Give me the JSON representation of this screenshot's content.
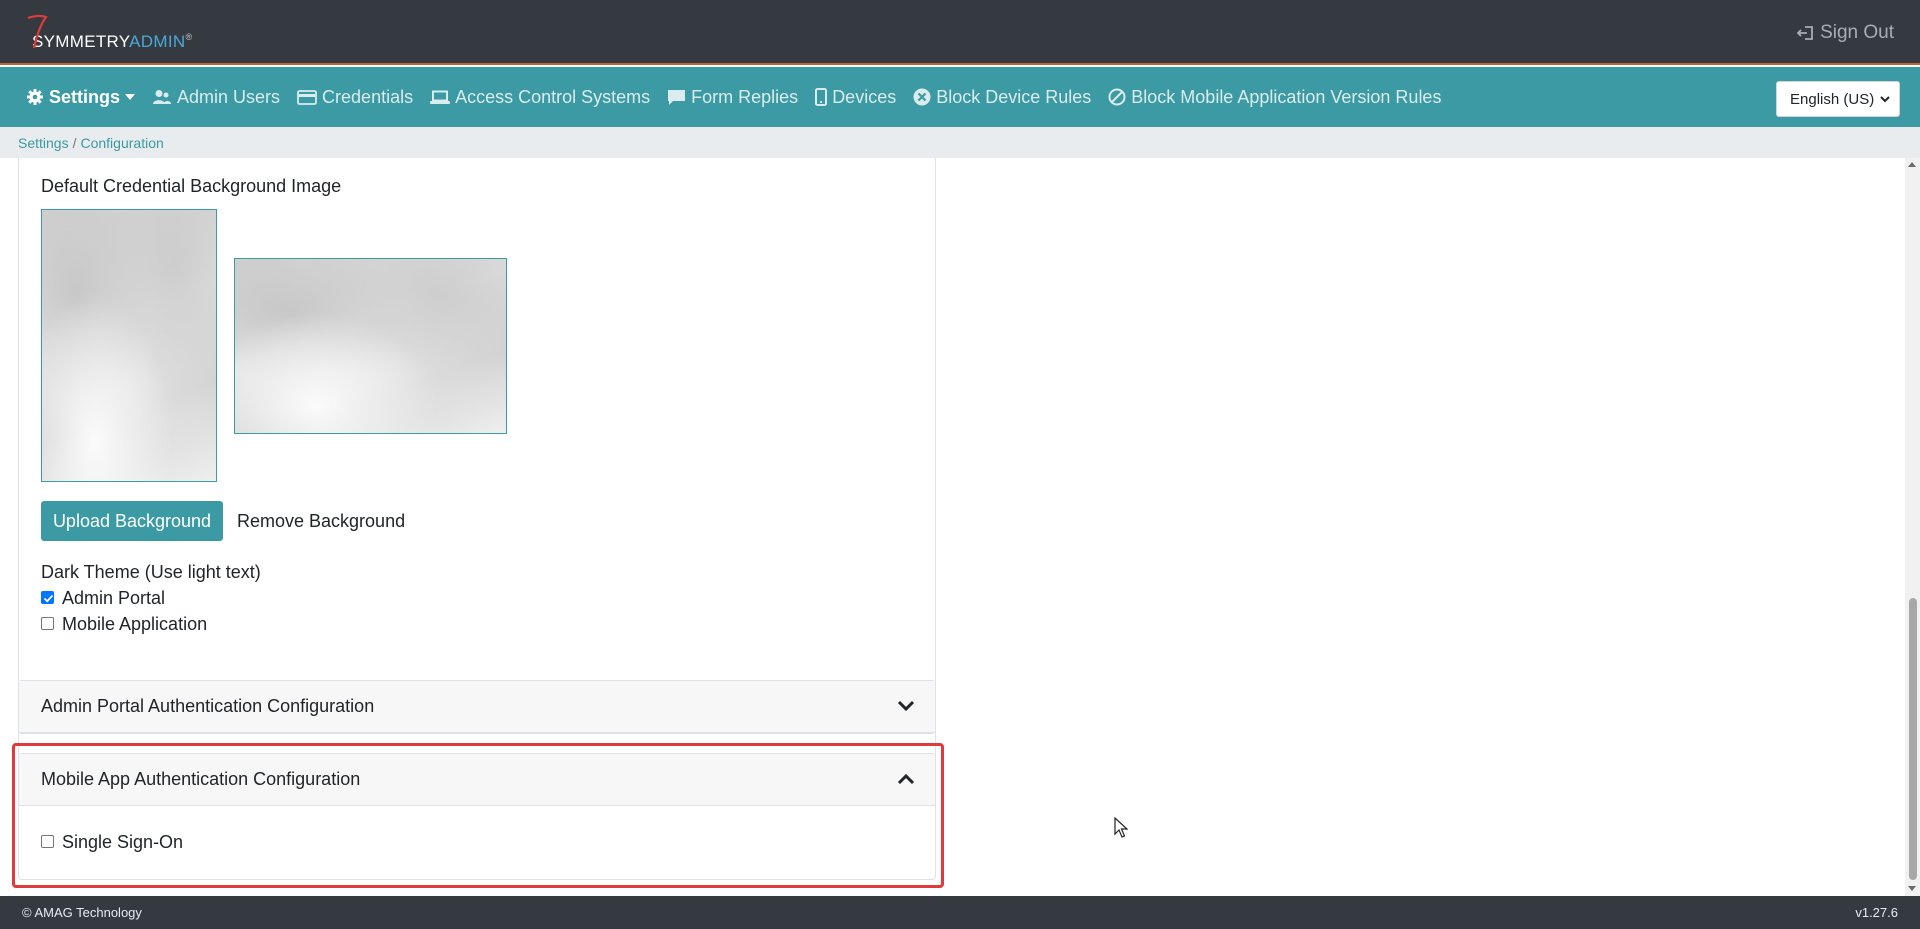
{
  "brand": {
    "name_part1": "SYMMETRY",
    "name_part2": "ADMIN",
    "tm": "®",
    "accent": "#3b9aa3",
    "topbar_color": "#343a40"
  },
  "header": {
    "sign_out_label": "Sign Out"
  },
  "nav": {
    "items": [
      {
        "label": "Settings",
        "icon": "gear-icon",
        "active": true
      },
      {
        "label": "Admin Users",
        "icon": "users-icon"
      },
      {
        "label": "Credentials",
        "icon": "credit-card-icon"
      },
      {
        "label": "Access Control Systems",
        "icon": "laptop-icon"
      },
      {
        "label": "Form Replies",
        "icon": "comment-icon"
      },
      {
        "label": "Devices",
        "icon": "mobile-icon"
      },
      {
        "label": "Block Device Rules",
        "icon": "times-circle-icon"
      },
      {
        "label": "Block Mobile Application Version Rules",
        "icon": "ban-icon"
      }
    ],
    "language": "English (US)"
  },
  "breadcrumb": {
    "parent": "Settings",
    "separator": "/",
    "current": "Configuration"
  },
  "appearance": {
    "bg_image_label": "Default Credential Background Image",
    "upload_label": "Upload Background",
    "remove_label": "Remove Background",
    "dark_theme_label": "Dark Theme (Use light text)",
    "admin_portal_label": "Admin Portal",
    "admin_portal_checked": true,
    "mobile_app_label": "Mobile Application",
    "mobile_app_checked": false
  },
  "admin_auth": {
    "title": "Admin Portal Authentication Configuration",
    "expanded": false
  },
  "mobile_auth": {
    "title": "Mobile App Authentication Configuration",
    "expanded": true,
    "sso_label": "Single Sign-On",
    "sso_checked": false
  },
  "footer": {
    "copyright": "© AMAG Technology",
    "version": "v1.27.6"
  }
}
